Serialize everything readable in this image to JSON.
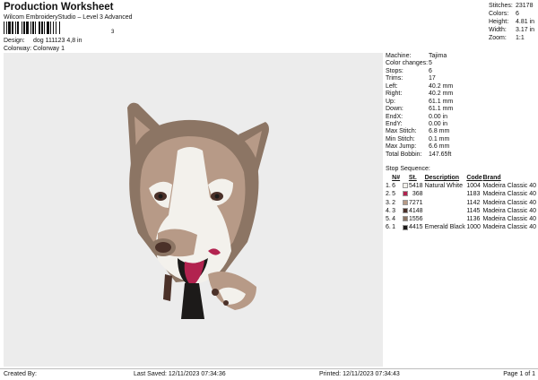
{
  "header": {
    "title": "Production Worksheet",
    "software": "Wilcom EmbroideryStudio – Level 3 Advanced",
    "design_label": "Design:",
    "design_value": "dog 111123 4,8 in",
    "colorway_label": "Colorway:",
    "colorway_value": "Colorway 1",
    "barcode_mark": "3"
  },
  "stats": [
    {
      "label": "Stitches:",
      "value": "23178"
    },
    {
      "label": "Colors:",
      "value": "6"
    },
    {
      "label": "Height:",
      "value": "4.81 in"
    },
    {
      "label": "Width:",
      "value": "3.17 in"
    },
    {
      "label": "Zoom:",
      "value": "1:1"
    }
  ],
  "params": [
    {
      "label": "Machine:",
      "value": "Tajima"
    },
    {
      "label": "Color changes:",
      "value": "5"
    },
    {
      "label": "Stops:",
      "value": "6"
    },
    {
      "label": "Trims:",
      "value": "17"
    },
    {
      "label": "Left:",
      "value": "40.2 mm"
    },
    {
      "label": "Right:",
      "value": "40.2 mm"
    },
    {
      "label": "Up:",
      "value": "61.1 mm"
    },
    {
      "label": "Down:",
      "value": "61.1 mm"
    },
    {
      "label": "EndX:",
      "value": "0.00 in"
    },
    {
      "label": "EndY:",
      "value": "0.00 in"
    },
    {
      "label": "Max Stitch:",
      "value": "6.8 mm"
    },
    {
      "label": "Min Stitch:",
      "value": "0.1 mm"
    },
    {
      "label": "Max Jump:",
      "value": "6.6 mm"
    },
    {
      "label": "Total Bobbin:",
      "value": "147.65ft"
    }
  ],
  "stop_sequence": {
    "title": "Stop Sequence:",
    "headers": {
      "num": "N#",
      "st": "St.",
      "desc": "Description",
      "code": "Code",
      "brand": "Brand"
    },
    "rows": [
      {
        "idx": "1.",
        "num": "6",
        "color": "#f3f1ec",
        "st": "5418",
        "desc": "Natural White",
        "code": "1004",
        "brand": "Madeira Classic 40"
      },
      {
        "idx": "2.",
        "num": "5",
        "color": "#b2234f",
        "st": "368",
        "desc": "",
        "code": "1183",
        "brand": "Madeira Classic 40"
      },
      {
        "idx": "3.",
        "num": "2",
        "color": "#b79a87",
        "st": "7271",
        "desc": "",
        "code": "1142",
        "brand": "Madeira Classic 40"
      },
      {
        "idx": "4.",
        "num": "3",
        "color": "#4b3129",
        "st": "4148",
        "desc": "",
        "code": "1145",
        "brand": "Madeira Classic 40"
      },
      {
        "idx": "5.",
        "num": "4",
        "color": "#8c7564",
        "st": "1556",
        "desc": "",
        "code": "1136",
        "brand": "Madeira Classic 40"
      },
      {
        "idx": "6.",
        "num": "1",
        "color": "#1c1a19",
        "st": "4415",
        "desc": "Emerald Black",
        "code": "1000",
        "brand": "Madeira Classic 40"
      }
    ]
  },
  "footer": {
    "created": "Created By:",
    "saved": "Last Saved: 12/11/2023 07:34:36",
    "printed": "Printed: 12/11/2023 07:34:43",
    "page": "Page 1 of 1"
  }
}
